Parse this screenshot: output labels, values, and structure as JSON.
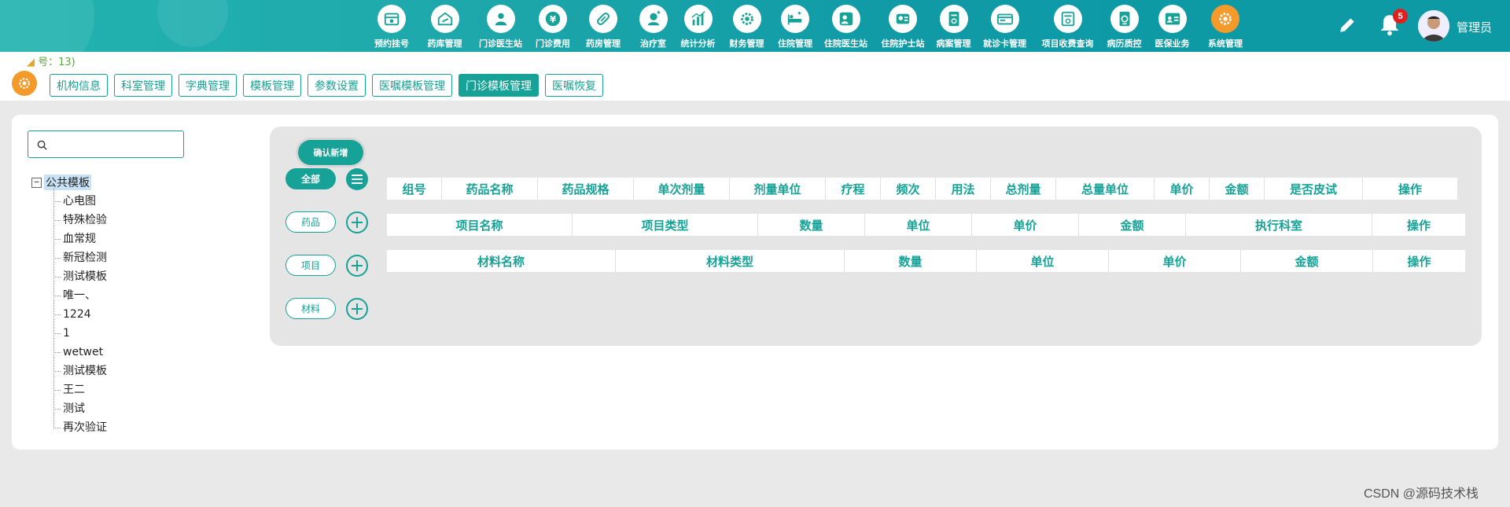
{
  "header": {
    "nav": [
      {
        "label": "预约挂号",
        "icon": "calendar-icon"
      },
      {
        "label": "药库管理",
        "icon": "warehouse-icon"
      },
      {
        "label": "门诊医生站",
        "icon": "doctor-icon"
      },
      {
        "label": "门诊费用",
        "icon": "yen-icon"
      },
      {
        "label": "药房管理",
        "icon": "pill-icon"
      },
      {
        "label": "治疗室",
        "icon": "nurse-icon"
      },
      {
        "label": "统计分析",
        "icon": "bar-chart-icon"
      },
      {
        "label": "财务管理",
        "icon": "finance-gear-icon"
      },
      {
        "label": "住院管理",
        "icon": "hospital-bed-icon"
      },
      {
        "label": "住院医生站",
        "icon": "inpatient-doctor-icon"
      },
      {
        "label": "住院护士站",
        "icon": "inpatient-nurse-icon"
      },
      {
        "label": "病案管理",
        "icon": "medical-record-icon"
      },
      {
        "label": "就诊卡管理",
        "icon": "card-icon"
      },
      {
        "label": "项目收费查询",
        "icon": "fee-query-icon"
      },
      {
        "label": "病历质控",
        "icon": "quality-control-icon"
      },
      {
        "label": "医保业务",
        "icon": "insurance-icon"
      },
      {
        "label": "系统管理",
        "icon": "system-gear-icon"
      }
    ],
    "active_nav": "系统管理",
    "notification_count": "5",
    "username": "管理员"
  },
  "subbar": {
    "hint": "号：13)",
    "tabs": [
      "机构信息",
      "科室管理",
      "字典管理",
      "模板管理",
      "参数设置",
      "医嘱模板管理",
      "门诊模板管理",
      "医嘱恢复"
    ],
    "active_tab": "门诊模板管理"
  },
  "left": {
    "search_value": "",
    "tree": {
      "root": "公共模板",
      "toggle": "−",
      "children": [
        "心电图",
        "特殊检验",
        "血常规",
        "新冠检测",
        "测试模板",
        "唯一、",
        "1224",
        "1",
        "wetwet",
        "测试模板",
        "王二",
        "测试",
        "再次验证"
      ]
    }
  },
  "right": {
    "confirm_button": "确认新增",
    "filters": [
      {
        "label": "全部",
        "action": "list"
      },
      {
        "label": "药品",
        "action": "add"
      },
      {
        "label": "项目",
        "action": "add"
      },
      {
        "label": "材料",
        "action": "add"
      }
    ],
    "tables": [
      {
        "name": "drug-table",
        "headers": [
          "组号",
          "药品名称",
          "药品规格",
          "单次剂量",
          "剂量单位",
          "疗程",
          "频次",
          "用法",
          "总剂量",
          "总量单位",
          "单价",
          "金额",
          "是否皮试",
          "操作"
        ]
      },
      {
        "name": "item-table",
        "headers": [
          "项目名称",
          "项目类型",
          "数量",
          "单位",
          "单价",
          "金额",
          "执行科室",
          "操作"
        ]
      },
      {
        "name": "material-table",
        "headers": [
          "材料名称",
          "材料类型",
          "数量",
          "单位",
          "单价",
          "金额",
          "操作"
        ]
      }
    ]
  },
  "watermark": "CSDN @源码技术栈",
  "colors": {
    "primary": "#16a297",
    "accent": "#f39a2b",
    "badge": "#e02020"
  }
}
